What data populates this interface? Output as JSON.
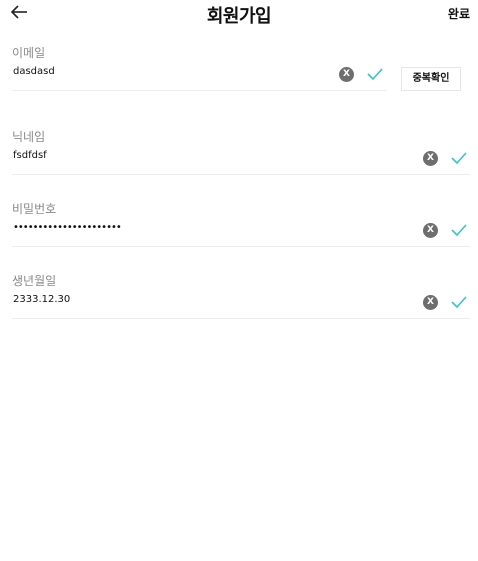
{
  "header": {
    "title": "회원가입",
    "done_label": "완료"
  },
  "fields": {
    "email": {
      "label": "이메일",
      "value": "dasdasd",
      "check_button": "중복확인"
    },
    "nickname": {
      "label": "닉네임",
      "value": "fsdfdsf"
    },
    "password": {
      "label": "비밀번호",
      "value": "••••••••••••••••••••••"
    },
    "birthdate": {
      "label": "생년월일",
      "value": "2333.12.30"
    }
  },
  "icons": {
    "back": "arrow-left-icon",
    "clear": "clear-circle-icon",
    "valid": "check-icon",
    "clear_glyph": "X"
  },
  "colors": {
    "check": "#33c3d3",
    "clear_bg": "#6e6e6e"
  }
}
